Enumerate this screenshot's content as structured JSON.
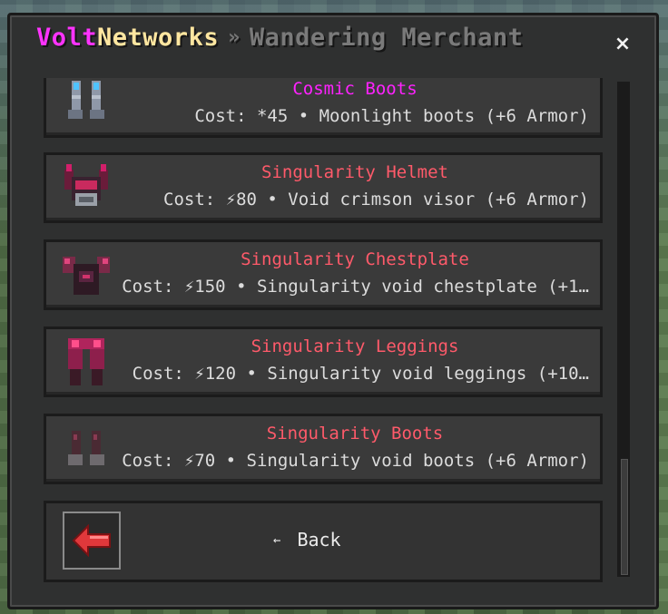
{
  "header": {
    "brand_volt": "Volt",
    "brand_networks": "Networks",
    "separator": "»",
    "page_title": "Wandering Merchant",
    "close_label": "×"
  },
  "items": [
    {
      "name": "Cosmic Boots",
      "description": "Cost: *45 • Moonlight boots (+6 Armor)",
      "name_color": "#ff22ff",
      "icon": "cosmic-boots-icon"
    },
    {
      "name": "Singularity Helmet",
      "description": "Cost: ⚡80 • Void crimson visor (+6 Armor)",
      "name_color": "#ff5a6a",
      "icon": "singularity-helmet-icon"
    },
    {
      "name": "Singularity Chestplate",
      "description": "Cost: ⚡150 • Singularity void chestplate (+1…",
      "name_color": "#ff5a6a",
      "icon": "singularity-chestplate-icon"
    },
    {
      "name": "Singularity Leggings",
      "description": "Cost: ⚡120 • Singularity void leggings (+10…",
      "name_color": "#ff5a6a",
      "icon": "singularity-leggings-icon"
    },
    {
      "name": "Singularity Boots",
      "description": "Cost: ⚡70 • Singularity void boots (+6 Armor)",
      "name_color": "#ff5a6a",
      "icon": "singularity-boots-icon"
    }
  ],
  "back": {
    "arrow": "←",
    "label": "Back",
    "icon": "red-back-arrow-icon"
  }
}
